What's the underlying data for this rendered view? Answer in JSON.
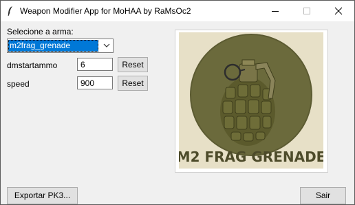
{
  "window": {
    "title": "Weapon Modifier App for MoHAA by RaMsOc2",
    "icons": {
      "app": "feather-icon",
      "minimize": "minimize-icon",
      "maximize": "maximize-icon",
      "close": "close-icon"
    }
  },
  "weapon_select": {
    "label": "Selecione a arma:",
    "value": "m2frag_grenade",
    "dropdown_icon": "chevron-down-icon"
  },
  "fields": [
    {
      "label": "dmstartammo",
      "value": "6",
      "reset_label": "Reset"
    },
    {
      "label": "speed",
      "value": "900",
      "reset_label": "Reset"
    }
  ],
  "preview": {
    "caption": "M2 FRAG GRENADE",
    "image": "grenade-image",
    "colors": {
      "background": "#e7e0c7",
      "disc": "#6b6a3c",
      "text": "#4d4b2a"
    }
  },
  "footer": {
    "export_label": "Exportar PK3...",
    "exit_label": "Sair"
  }
}
